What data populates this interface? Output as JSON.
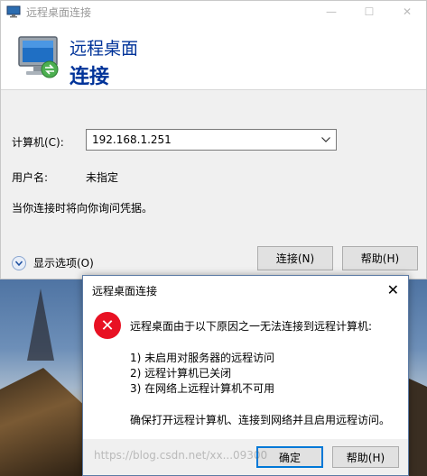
{
  "window": {
    "title": "远程桌面连接",
    "controls": {
      "minimize": "—",
      "maximize": "☐",
      "close": "✕"
    }
  },
  "banner": {
    "line1": "远程桌面",
    "line2": "连接"
  },
  "form": {
    "computer_label": "计算机(C):",
    "computer_value": "192.168.1.251",
    "username_label": "用户名:",
    "username_value": "未指定",
    "credential_note": "当你连接时将向你询问凭据。"
  },
  "show_options": "显示选项(O)",
  "buttons": {
    "connect": "连接(N)",
    "help": "帮助(H)"
  },
  "dialog": {
    "title": "远程桌面连接",
    "close": "✕",
    "icon_glyph": "✕",
    "message_heading": "远程桌面由于以下原因之一无法连接到远程计算机:",
    "reasons": [
      "1) 未启用对服务器的远程访问",
      "2) 远程计算机已关闭",
      "3) 在网络上远程计算机不可用"
    ],
    "advice": "确保打开远程计算机、连接到网络并且启用远程访问。",
    "ok_label": "确定",
    "help_label": "帮助(H)"
  },
  "watermark": "https://blog.csdn.net/xx...09300",
  "colors": {
    "accent": "#0078d7",
    "error": "#e81123",
    "banner_text": "#003399"
  },
  "icons": {
    "app": "remote-desktop-icon",
    "error": "error-icon",
    "dropdown": "chevron-down-icon",
    "options": "expand-options-icon"
  }
}
